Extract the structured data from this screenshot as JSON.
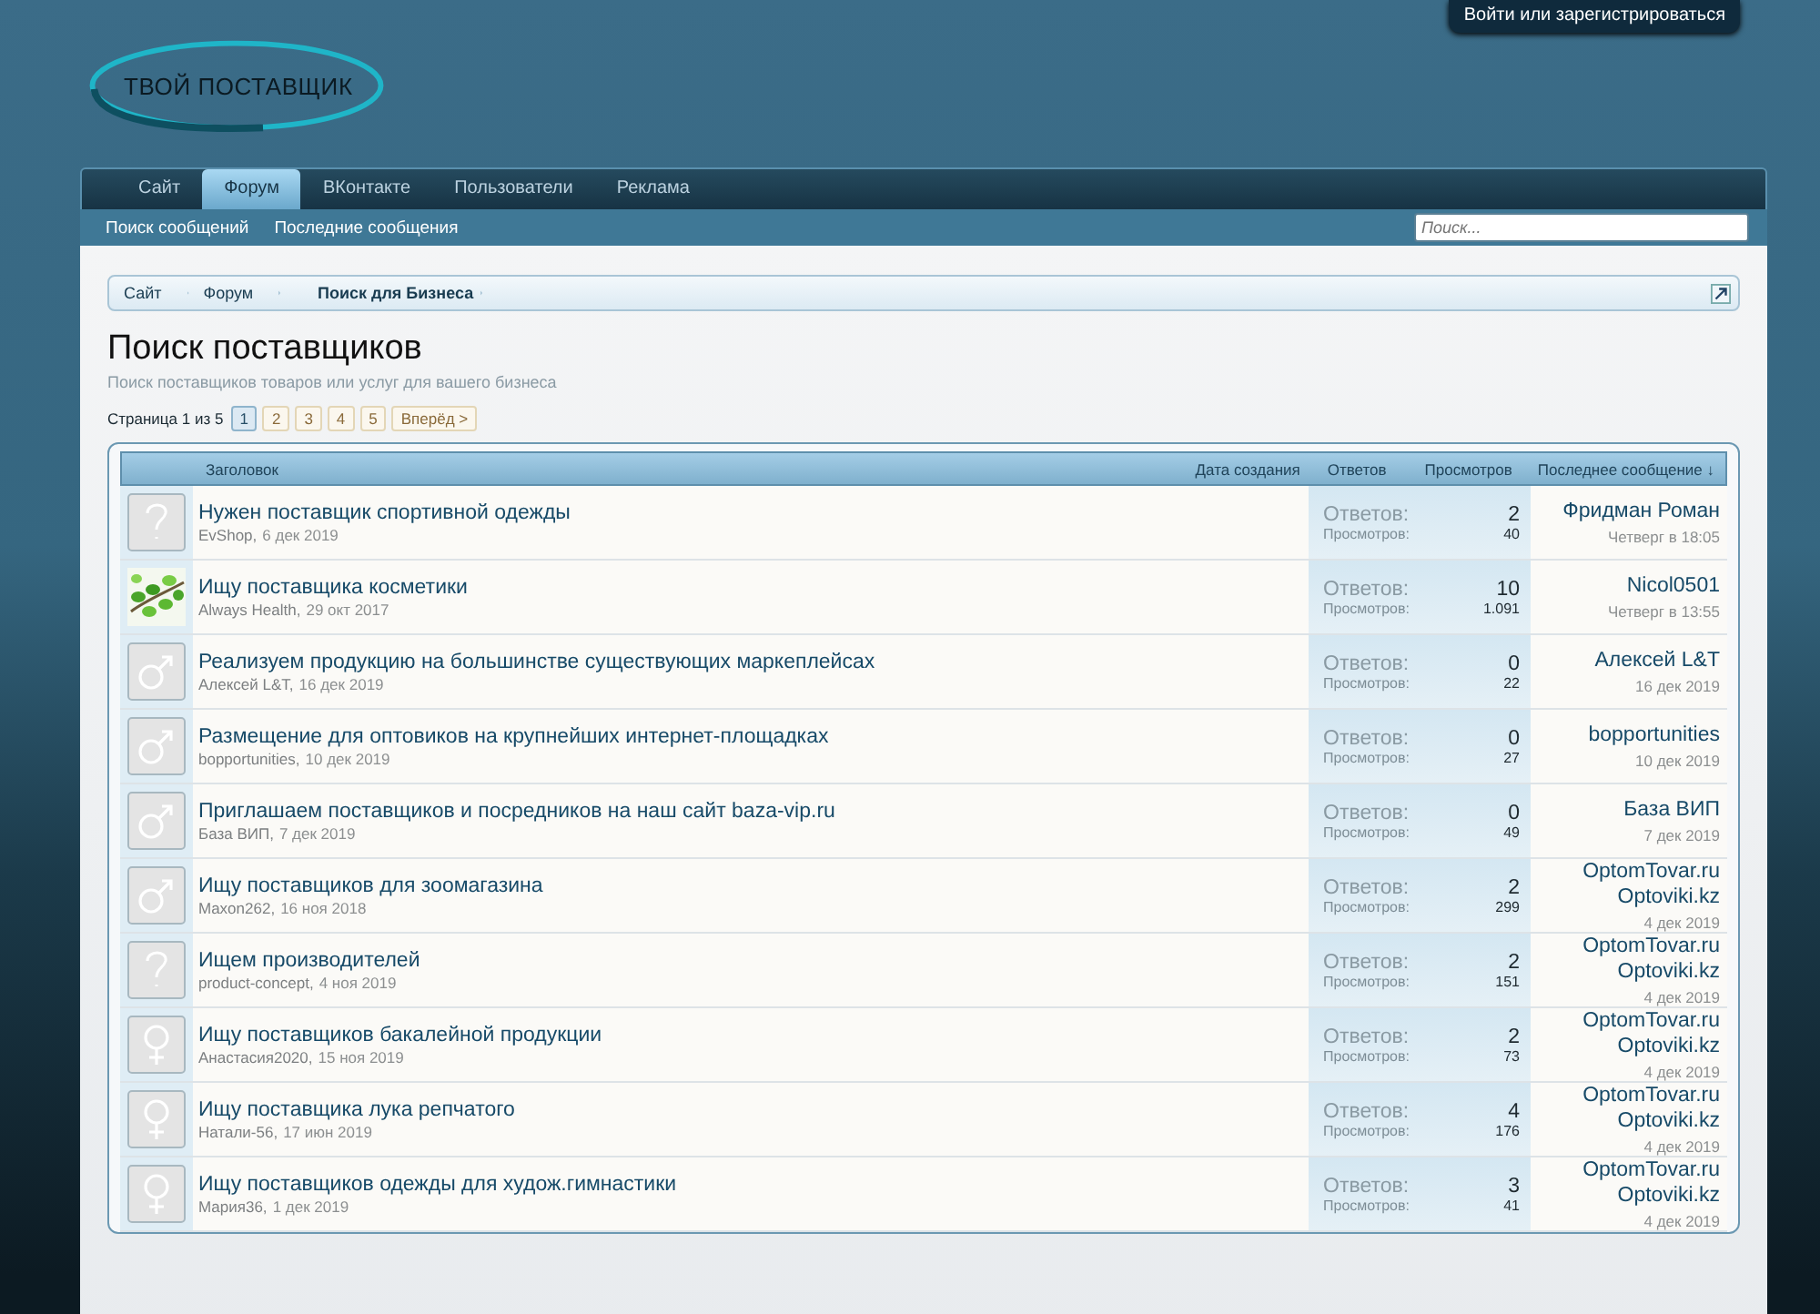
{
  "header": {
    "logo_text": "ТВОЙ ПОСТАВЩИК",
    "login_link": "Войти или зарегистрироваться"
  },
  "tabs": [
    {
      "label": "Сайт",
      "selected": false
    },
    {
      "label": "Форум",
      "selected": true
    },
    {
      "label": "ВКонтакте",
      "selected": false
    },
    {
      "label": "Пользователи",
      "selected": false
    },
    {
      "label": "Реклама",
      "selected": false
    }
  ],
  "sub_tabs": [
    "Поиск сообщений",
    "Последние сообщения"
  ],
  "search": {
    "placeholder": "Поиск..."
  },
  "breadcrumbs": [
    "Сайт",
    "Форум",
    "Поиск для Бизнеса"
  ],
  "page": {
    "title": "Поиск поставщиков",
    "description": "Поиск поставщиков товаров или услуг для вашего бизнеса"
  },
  "pagination": {
    "label": "Страница 1 из 5",
    "pages": [
      {
        "label": "1",
        "selected": true
      },
      {
        "label": "2",
        "selected": false
      },
      {
        "label": "3",
        "selected": false
      },
      {
        "label": "4",
        "selected": false
      },
      {
        "label": "5",
        "selected": false
      }
    ],
    "next": "Вперёд >"
  },
  "table": {
    "columns": [
      "Заголовок",
      "Дата создания",
      "Ответов",
      "Просмотров",
      "Последнее сообщение ↓"
    ],
    "rows": [
      {
        "kind": "question",
        "title": "Нужен поставщик спортивной одежды",
        "author": "EvShop,",
        "date": "6 дек 2019",
        "replies_label": "Ответов:",
        "replies": "2",
        "views_label": "Просмотров:",
        "views": "40",
        "last_user": "Фридман Роман",
        "last_date": "Четверг в 18:05"
      },
      {
        "kind": "picture",
        "title": "Ищу поставщика косметики",
        "author": "Always Health,",
        "date": "29 окт 2017",
        "replies_label": "Ответов:",
        "replies": "10",
        "views_label": "Просмотров:",
        "views": "1.091",
        "last_user": "Nicol0501",
        "last_date": "Четверг в 13:55"
      },
      {
        "kind": "male",
        "title": "Реализуем продукцию на большинстве существующих маркеплейсах",
        "author": "Алексей L&T,",
        "date": "16 дек 2019",
        "replies_label": "Ответов:",
        "replies": "0",
        "views_label": "Просмотров:",
        "views": "22",
        "last_user": "Алексей L&T",
        "last_date": "16 дек 2019"
      },
      {
        "kind": "male",
        "title": "Размещение для оптовиков на крупнейших интернет-площадках",
        "author": "bopportunities,",
        "date": "10 дек 2019",
        "replies_label": "Ответов:",
        "replies": "0",
        "views_label": "Просмотров:",
        "views": "27",
        "last_user": "bopportunities",
        "last_date": "10 дек 2019"
      },
      {
        "kind": "male",
        "title": "Приглашаем поставщиков и посредников на наш сайт baza-vip.ru",
        "author": "База ВИП,",
        "date": "7 дек 2019",
        "replies_label": "Ответов:",
        "replies": "0",
        "views_label": "Просмотров:",
        "views": "49",
        "last_user": "База ВИП",
        "last_date": "7 дек 2019"
      },
      {
        "kind": "male",
        "title": "Ищу поставщиков для зоомагазина",
        "author": "Maxon262,",
        "date": "16 ноя 2018",
        "replies_label": "Ответов:",
        "replies": "2",
        "views_label": "Просмотров:",
        "views": "299",
        "last_user": "OptomTovar.ru Optoviki.kz",
        "last_date": "4 дек 2019"
      },
      {
        "kind": "question",
        "title": "Ищем производителей",
        "author": "product-concept,",
        "date": "4 ноя 2019",
        "replies_label": "Ответов:",
        "replies": "2",
        "views_label": "Просмотров:",
        "views": "151",
        "last_user": "OptomTovar.ru Optoviki.kz",
        "last_date": "4 дек 2019"
      },
      {
        "kind": "female",
        "title": "Ищу поставщиков бакалейной продукции",
        "author": "Анастасия2020,",
        "date": "15 ноя 2019",
        "replies_label": "Ответов:",
        "replies": "2",
        "views_label": "Просмотров:",
        "views": "73",
        "last_user": "OptomTovar.ru Optoviki.kz",
        "last_date": "4 дек 2019"
      },
      {
        "kind": "female",
        "title": "Ищу поставщика лука репчатого",
        "author": "Натали-56,",
        "date": "17 июн 2019",
        "replies_label": "Ответов:",
        "replies": "4",
        "views_label": "Просмотров:",
        "views": "176",
        "last_user": "OptomTovar.ru Optoviki.kz",
        "last_date": "4 дек 2019"
      },
      {
        "kind": "female",
        "title": "Ищу поставщиков одежды для худож.гимнастики",
        "author": "Мария36,",
        "date": "1 дек 2019",
        "replies_label": "Ответов:",
        "replies": "3",
        "views_label": "Просмотров:",
        "views": "41",
        "last_user": "OptomTovar.ru Optoviki.kz",
        "last_date": "4 дек 2019"
      }
    ]
  }
}
